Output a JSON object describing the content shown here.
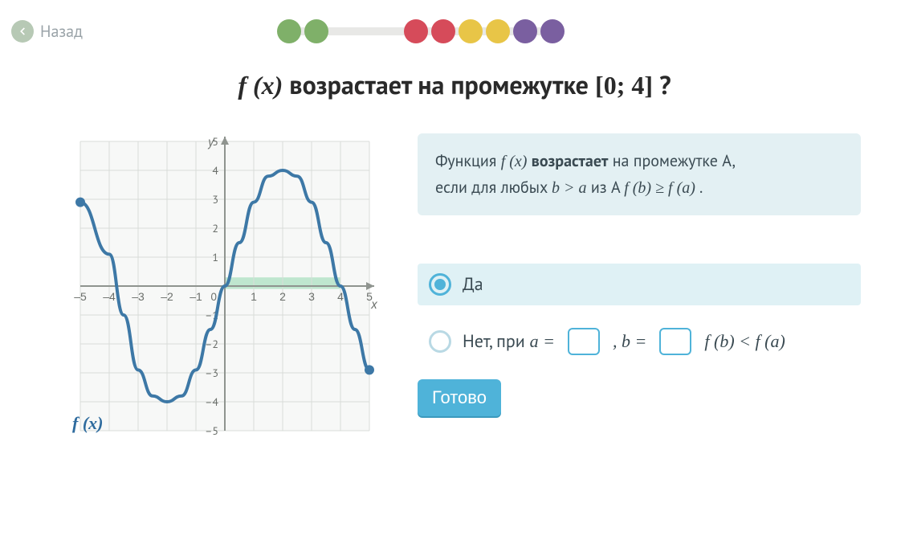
{
  "nav": {
    "back_label": "Назад"
  },
  "progress": {
    "dots": [
      "green",
      "green",
      "gap",
      "red",
      "red",
      "yellow",
      "yellow",
      "purple",
      "purple"
    ]
  },
  "question": {
    "fx": "f (x)",
    "text_mid": " возрастает на промежутке ",
    "interval": "[0; 4]",
    "qmark": " ?"
  },
  "hint": {
    "l1a": "Функция ",
    "l1fx": "f (x)",
    "l1b": " ",
    "l1bold": "возрастает",
    "l1c": " на промежутке A,",
    "l2a": "если для любых  ",
    "l2m1": "b > a",
    "l2b": "  из A ",
    "l2m2": "f (b) ≥ f (a)",
    "l2c": " ."
  },
  "options": {
    "yes": "Да",
    "no_pre": "Нет, при ",
    "a_eq": "a =",
    "comma": ", ",
    "b_eq": "b =",
    "tail": " f (b) < f (a)"
  },
  "inputs": {
    "a": "",
    "b": ""
  },
  "submit": "Готово",
  "graph": {
    "y_label": "y",
    "x_label": "x",
    "fx_label": "f (x)",
    "x_ticks": [
      "–5",
      "–4",
      "–3",
      "–2",
      "–1",
      "0",
      "1",
      "2",
      "3",
      "4",
      "5"
    ],
    "y_ticks_pos": [
      "1",
      "2",
      "3",
      "4",
      "5"
    ],
    "y_ticks_neg": [
      "–1",
      "–2",
      "–3",
      "–4",
      "–5"
    ]
  },
  "chart_data": {
    "type": "line",
    "title": "",
    "xlabel": "x",
    "ylabel": "y",
    "xlim": [
      -5,
      5
    ],
    "ylim": [
      -5,
      5
    ],
    "highlight_interval": [
      0,
      4
    ],
    "series": [
      {
        "name": "f(x)",
        "points": [
          {
            "x": -5,
            "y": 2.9
          },
          {
            "x": -4,
            "y": 1.1
          },
          {
            "x": -3.5,
            "y": -1.0
          },
          {
            "x": -3,
            "y": -2.9
          },
          {
            "x": -2.5,
            "y": -3.8
          },
          {
            "x": -2,
            "y": -4.0
          },
          {
            "x": -1.5,
            "y": -3.8
          },
          {
            "x": -1,
            "y": -2.9
          },
          {
            "x": -0.5,
            "y": -1.5
          },
          {
            "x": 0,
            "y": 0.0
          },
          {
            "x": 0.5,
            "y": 1.5
          },
          {
            "x": 1,
            "y": 2.9
          },
          {
            "x": 1.5,
            "y": 3.8
          },
          {
            "x": 2,
            "y": 4.0
          },
          {
            "x": 2.5,
            "y": 3.8
          },
          {
            "x": 3,
            "y": 2.9
          },
          {
            "x": 3.5,
            "y": 1.5
          },
          {
            "x": 4,
            "y": 0.0
          },
          {
            "x": 4.5,
            "y": -1.5
          },
          {
            "x": 5,
            "y": -2.9
          }
        ]
      }
    ]
  }
}
